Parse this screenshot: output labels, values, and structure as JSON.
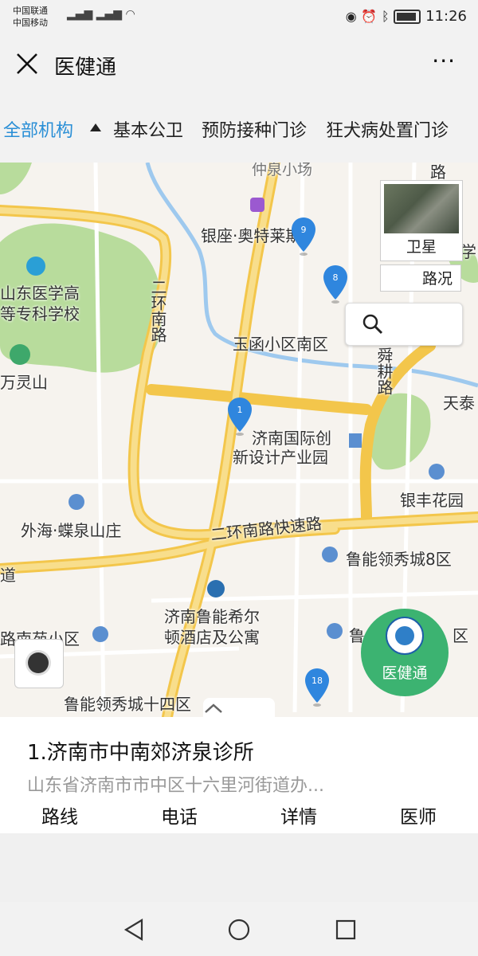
{
  "status_bar": {
    "carrier_1": "中国联通",
    "carrier_2": "中国移动",
    "time": "11:26"
  },
  "title_bar": {
    "title": "医健通",
    "more_label": "···"
  },
  "filters": [
    {
      "label": "全部机构",
      "active": true
    },
    {
      "label": "基本公卫",
      "active": false
    },
    {
      "label": "预防接种门诊",
      "active": false
    },
    {
      "label": "狂犬病处置门诊",
      "active": false
    }
  ],
  "map": {
    "satellite_label": "卫星",
    "traffic_label": "路况",
    "brand_label": "医健通",
    "labels": {
      "yinzuo": "银座·奥特莱斯",
      "school_1": "山东医学高",
      "school_2": "等专科学校",
      "wanlingshan": "万灵山",
      "erhuannan_road": "二环南路",
      "yuhan": "玉函小区南区",
      "shungeng_road": "舜耕路",
      "tiantai": "天泰",
      "park_1": "济南国际创",
      "park_2": "新设计产业园",
      "yinfeng": "银丰花园",
      "waihai": "外海·蝶泉山庄",
      "expressway": "二环南路快速路",
      "luneng_8": "鲁能领秀城8区",
      "hilton_1": "济南鲁能希尔",
      "hilton_2": "顿酒店及公寓",
      "lunan_yuan": "路南苑小区",
      "luneng_14": "鲁能领秀城十四区",
      "lu_partial": "鲁",
      "qu_partial": "区",
      "road_partial": "道",
      "xue_partial": "学",
      "lu_top": "路",
      "top_partial": "仲泉小场"
    },
    "pins": [
      {
        "number": "9"
      },
      {
        "number": "8"
      },
      {
        "number": "1"
      },
      {
        "number": "18"
      }
    ]
  },
  "card": {
    "title": "1.济南市中南郊济泉诊所",
    "address": "山东省济南市市中区十六里河街道办..."
  },
  "actions": [
    "路线",
    "电话",
    "详情",
    "医师"
  ],
  "colors": {
    "accent": "#2a8fd6",
    "brand_green": "#3cb371",
    "pin_blue": "#2f86de",
    "road_yellow": "#f7d774"
  }
}
